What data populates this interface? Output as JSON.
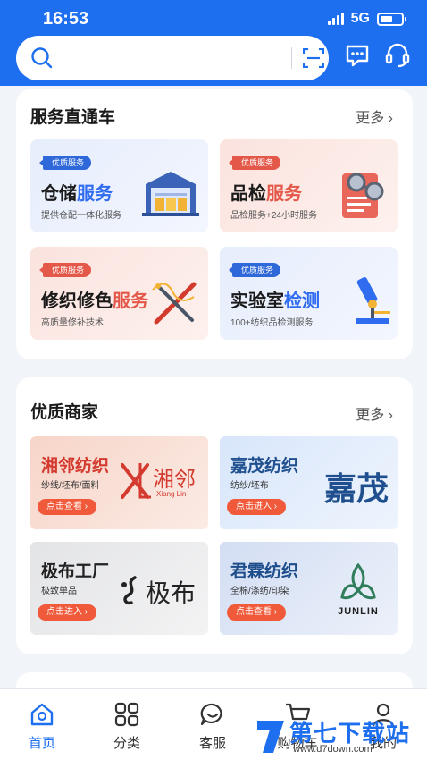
{
  "status_bar": {
    "time": "16:53",
    "network": "5G",
    "battery_level": 0.6
  },
  "search": {
    "placeholder": ""
  },
  "icons": {
    "search": "search-icon",
    "scan": "scan-icon",
    "message": "message-icon",
    "support": "headset-icon"
  },
  "services": {
    "title": "服务直通车",
    "more": "更多",
    "cards": [
      {
        "badge": "优质服务",
        "title_plain": "仓储",
        "title_accent": "服务",
        "subtitle": "提供仓配一体化服务",
        "theme": "blue",
        "icon": "warehouse-icon"
      },
      {
        "badge": "优质服务",
        "title_plain": "品检",
        "title_accent": "服务",
        "subtitle": "品检服务+24小时服务",
        "theme": "red",
        "icon": "inspection-icon"
      },
      {
        "badge": "优质服务",
        "title_plain": "修织修色",
        "title_accent": "服务",
        "subtitle": "高质量修补技术",
        "theme": "red",
        "icon": "needle-thread-icon"
      },
      {
        "badge": "优质服务",
        "title_plain": "实验室",
        "title_accent": "检测",
        "subtitle": "100+纺织品检测服务",
        "theme": "blue",
        "icon": "microscope-icon"
      }
    ]
  },
  "merchants": {
    "title": "优质商家",
    "more": "更多",
    "items": [
      {
        "name": "湘邻纺织",
        "tags": "纱线/坯布/面料",
        "button": "点击查看",
        "logo_text": "湘邻",
        "logo_sub": "Xiang Lin",
        "name_color": "#d43a2f"
      },
      {
        "name": "嘉茂纺织",
        "tags": "纺纱/坯布",
        "button": "点击进入",
        "logo_text": "嘉茂",
        "name_color": "#1f4f8f"
      },
      {
        "name": "极布工厂",
        "tags": "极致单品",
        "button": "点击进入",
        "logo_text": "极布",
        "name_color": "#222222"
      },
      {
        "name": "君霖纺织",
        "tags": "全棉/涤纺/印染",
        "button": "点击查看",
        "logo_text": "JUNLIN",
        "name_color": "#1e4d8c"
      }
    ]
  },
  "tabbar": {
    "items": [
      {
        "label": "首页",
        "icon": "home-icon",
        "active": true
      },
      {
        "label": "分类",
        "icon": "grid-icon",
        "active": false
      },
      {
        "label": "客服",
        "icon": "chat-bubble-icon",
        "active": false
      },
      {
        "label": "购物车",
        "icon": "cart-icon",
        "active": false
      },
      {
        "label": "我的",
        "icon": "profile-icon",
        "active": false
      }
    ]
  },
  "watermark": {
    "text": "第七下载站",
    "url": "www.d7down.com"
  },
  "colors": {
    "primary": "#1e6ff0",
    "accent_red": "#e4584a",
    "background": "#f1f4f9"
  }
}
